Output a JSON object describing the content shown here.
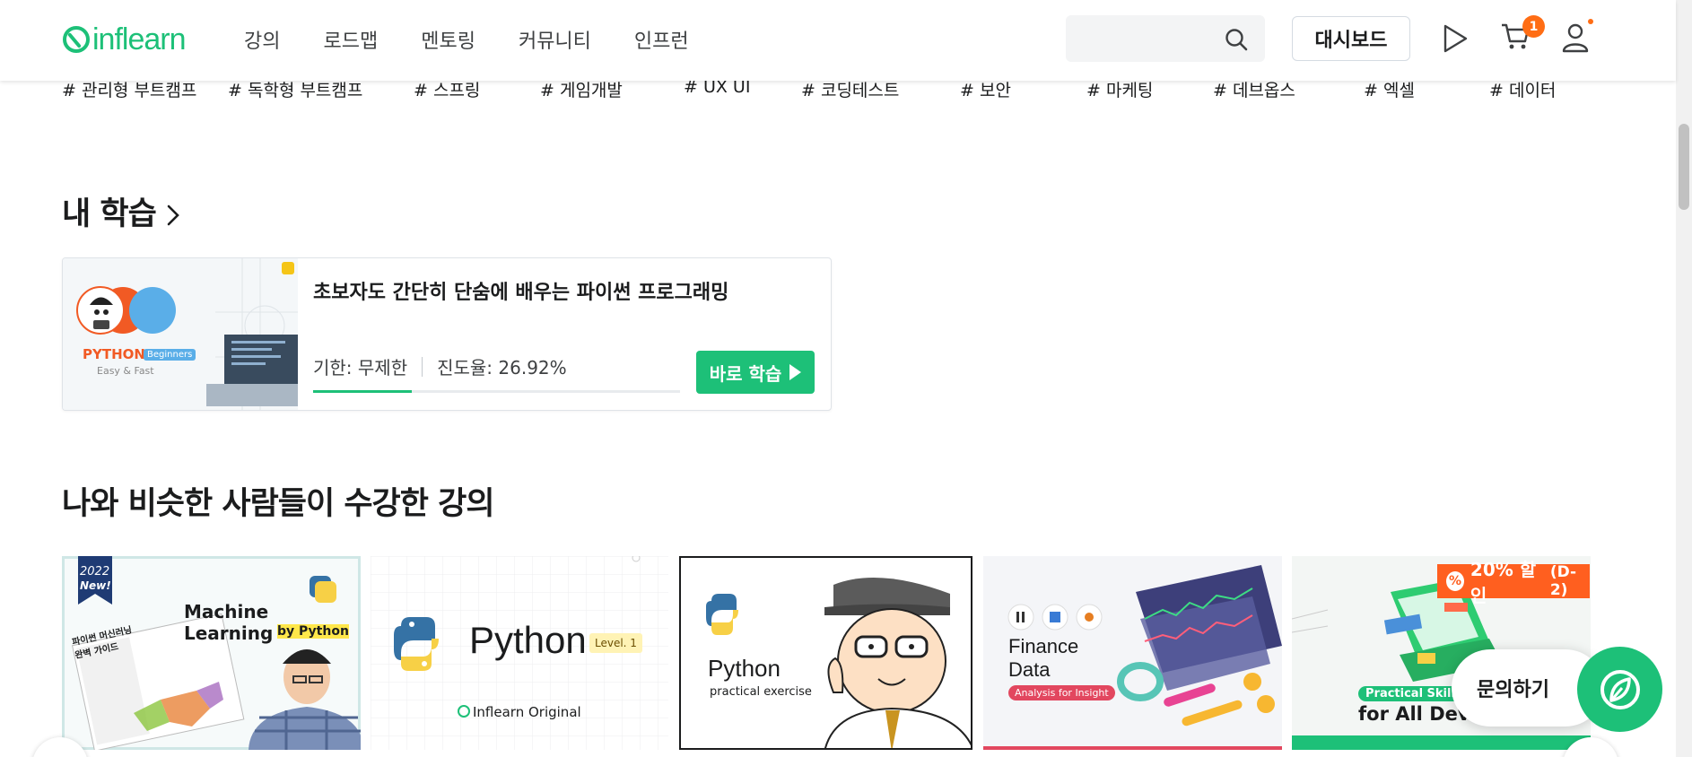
{
  "header": {
    "logo_text": "inflearn",
    "nav": [
      "강의",
      "로드맵",
      "멘토링",
      "커뮤니티",
      "인프런"
    ],
    "search_placeholder": "",
    "dashboard_label": "대시보드",
    "cart_count": "1"
  },
  "tags": [
    "# 관리형 부트캠프",
    "# 독학형 부트캠프",
    "# 스프링",
    "# 게임개발",
    "# UX UI",
    "# 코딩테스트",
    "# 보안",
    "# 마케팅",
    "# 데브옵스",
    "# 엑셀",
    "# 데이터"
  ],
  "my_learning": {
    "section_title": "내 학습",
    "course_title": "초보자도 간단히 단숨에 배우는 파이썬 프로그래밍",
    "period": "기한: 무제한",
    "progress_label": "진도율: 26.92%",
    "progress_percent": 26.92,
    "button_label": "바로 학습",
    "thumb": {
      "badge_title": "PYTHON",
      "badge_tag": "Beginners",
      "sub": "Easy & Fast"
    }
  },
  "recommended": {
    "section_title": "나와 비슷한 사람들이 수강한 강의",
    "courses": [
      {
        "year": "2022",
        "new": "New!",
        "title": "Machine Learning",
        "subtitle": "by Python",
        "book": "파이썬 머신러닝 완벽 가이드"
      },
      {
        "title": "Python",
        "level": "Level. 1",
        "brand": "Inflearn Original"
      },
      {
        "title": "Python",
        "subtitle": "practical exercise"
      },
      {
        "title": "Finance",
        "title2": "Data",
        "tag": "Analysis for Insight"
      },
      {
        "skill": "Practical Skill",
        "title": "for All Deve"
      }
    ],
    "discount": {
      "percent_symbol": "%",
      "label": "20% 할인",
      "dday": "(D-2)"
    }
  },
  "inquiry_label": "문의하기",
  "colors": {
    "brand": "#1dc078",
    "accent": "#ff6d14",
    "text": "#1b1c1d"
  }
}
